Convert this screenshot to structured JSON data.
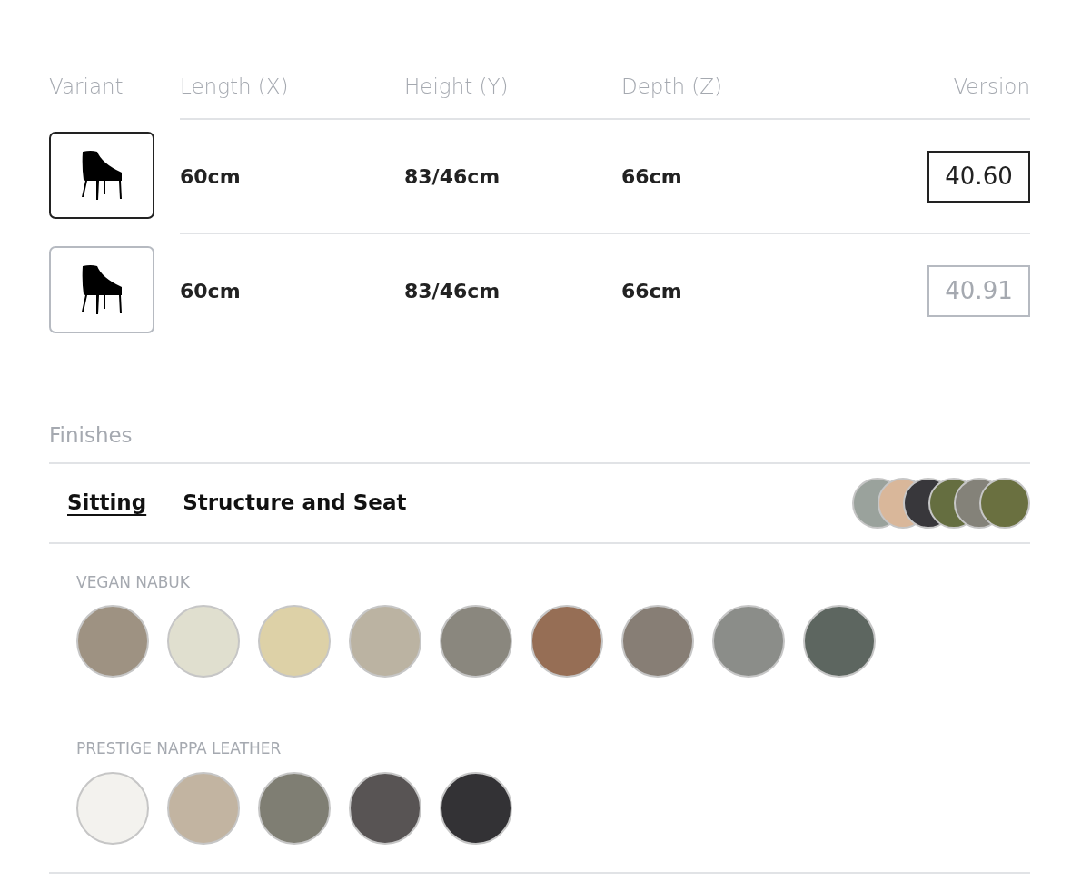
{
  "variants": {
    "columns": [
      "Variant",
      "Length (X)",
      "Height (Y)",
      "Depth (Z)",
      "Version"
    ],
    "rows": [
      {
        "selected": true,
        "length": "60cm",
        "height": "83/46cm",
        "depth": "66cm",
        "version": "40.60"
      },
      {
        "selected": false,
        "length": "60cm",
        "height": "83/46cm",
        "depth": "66cm",
        "version": "40.91"
      }
    ]
  },
  "finishes": {
    "title": "Finishes",
    "tabs": [
      {
        "label": "Sitting",
        "selected": true
      },
      {
        "label": "Structure and Seat",
        "selected": false
      }
    ],
    "preview_swatches": [
      {
        "color": "#9aa29c"
      },
      {
        "color": "#d9b79a"
      },
      {
        "color": "#38373b"
      },
      {
        "color": "#656e40"
      },
      {
        "color": "#848279"
      },
      {
        "color": "#6a7040"
      }
    ],
    "groups": [
      {
        "label": "VEGAN NABUK",
        "swatches": [
          {
            "color": "#9e9282"
          },
          {
            "color": "#e0dfcf"
          },
          {
            "color": "#ddd1a7"
          },
          {
            "color": "#bbb3a2"
          },
          {
            "color": "#8a877e"
          },
          {
            "color": "#966e55"
          },
          {
            "color": "#877e75"
          },
          {
            "color": "#8b8d89"
          },
          {
            "color": "#5d6660"
          }
        ]
      },
      {
        "label": "PRESTIGE NAPPA LEATHER",
        "swatches": [
          {
            "color": "#f3f2ee"
          },
          {
            "color": "#c2b4a1"
          },
          {
            "color": "#7f7e73"
          },
          {
            "color": "#585454"
          },
          {
            "color": "#333235"
          }
        ]
      }
    ]
  }
}
